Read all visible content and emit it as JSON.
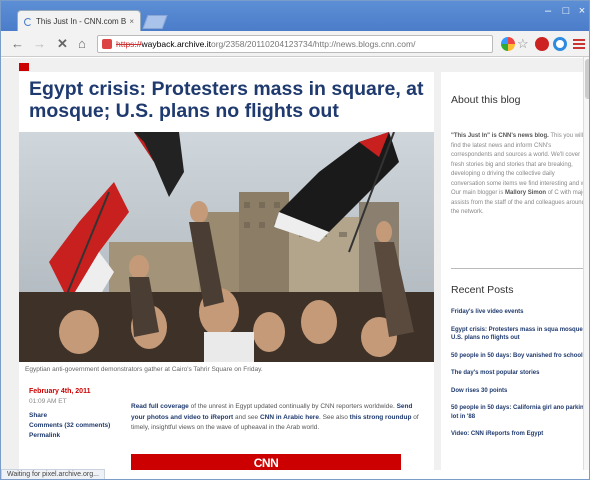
{
  "browser": {
    "tab_title": "This Just In - CNN.com Bl",
    "tab_close": "×",
    "window_min": "–",
    "window_max": "□",
    "window_close": "×",
    "url_proto": "https://",
    "url_host": "wayback.archive.it",
    "url_path": "org/2358/20110204123734/http://news.blogs.cnn.com/",
    "status_text": "Waiting for pixel.archive.org..."
  },
  "article": {
    "headline": "Egypt crisis: Protesters mass in square, at mosque; U.S. plans no flights out",
    "caption": "Egyptian anti-government demonstrators gather at Cairo's Tahrir Square on Friday.",
    "date": "February 4th, 2011",
    "time": "01:09 AM ET",
    "share": "Share",
    "comments": "Comments (32 comments)",
    "permalink": "Permalink",
    "body_link1": "Read full coverage",
    "body_text1": " of the unrest in Egypt updated continually by CNN reporters worldwide. ",
    "body_link2": "Send your photos and video to iReport",
    "body_text2": " and see ",
    "body_link3": "CNN in Arabic here",
    "body_text3": ". See also ",
    "body_link4": "this strong roundup",
    "body_text4": " of timely, insightful views on the wave of upheaval in the Arab world.",
    "cnn_logo": "CNN"
  },
  "sidebar": {
    "about_title": "About this blog",
    "about_bold": "\"This Just In\" is CNN's news blog.",
    "about_text": " This you will find the latest news and inform CNN's correspondents and sources a world. We'll cover fresh stories big and stories that are breaking, developing o driving the collective daily conversation some items we find interesting and w Our main blogger is ",
    "about_blogger": "Mallory Simon",
    "about_text2": " of C with major assists from the staff of the and colleagues around the network.",
    "recent_title": "Recent Posts",
    "posts": [
      "Friday's live video events",
      "Egypt crisis: Protesters mass in squa mosque; U.S. plans no flights out",
      "50 people in 50 days: Boy vanished fro school",
      "The day's most popular stories",
      "Dow rises 30 points",
      "50 people in 50 days: California girl ano parking lot in '88",
      "Video: CNN iReports from Egypt"
    ]
  }
}
